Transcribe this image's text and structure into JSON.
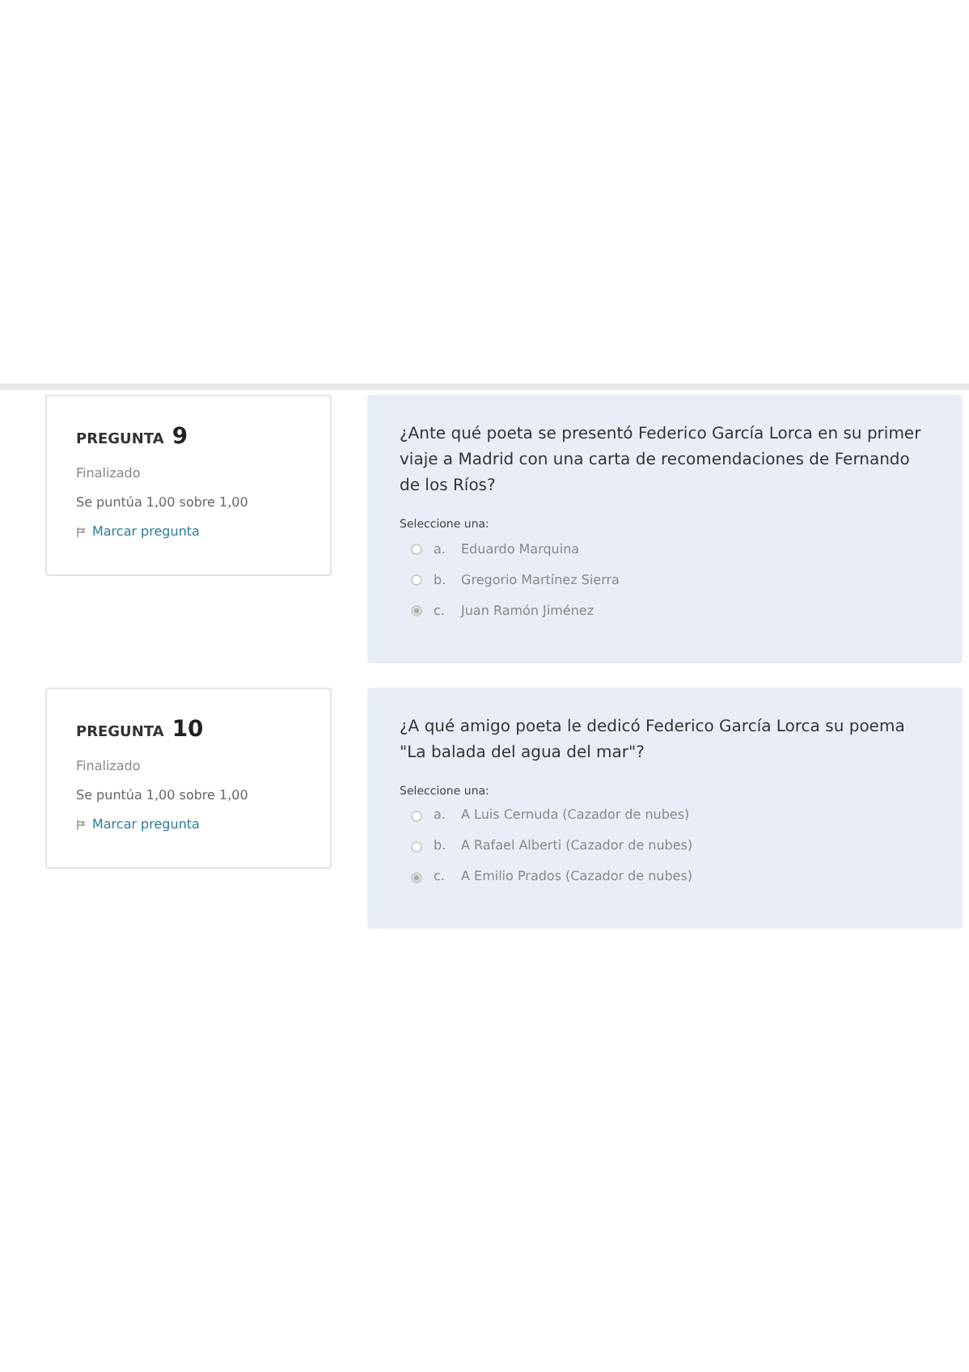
{
  "questions": [
    {
      "label": "PREGUNTA",
      "number": "9",
      "state": "Finalizado",
      "grade": "Se puntúa 1,00 sobre 1,00",
      "flag": "Marcar pregunta",
      "text": "¿Ante qué poeta se presentó Federico García Lorca en su primer viaje a Madrid con una carta de recomendaciones de Fernando de los Ríos?",
      "prompt": "Seleccione una:",
      "options": [
        {
          "letter": "a.",
          "text": "Eduardo Marquina",
          "selected": false
        },
        {
          "letter": "b.",
          "text": "Gregorio Martínez Sierra",
          "selected": false
        },
        {
          "letter": "c.",
          "text": "Juan Ramón Jiménez",
          "selected": true
        }
      ]
    },
    {
      "label": "PREGUNTA",
      "number": "10",
      "state": "Finalizado",
      "grade": "Se puntúa 1,00 sobre 1,00",
      "flag": "Marcar pregunta",
      "text": "¿A qué amigo poeta le dedicó Federico García Lorca su poema \"La balada del agua del mar\"?",
      "prompt": "Seleccione una:",
      "options": [
        {
          "letter": "a.",
          "text": "A Luis Cernuda (Cazador de nubes)",
          "selected": false
        },
        {
          "letter": "b.",
          "text": "A Rafael Alberti (Cazador de nubes)",
          "selected": false
        },
        {
          "letter": "c.",
          "text": "A Emilio Prados (Cazador de nubes)",
          "selected": true
        }
      ]
    }
  ]
}
